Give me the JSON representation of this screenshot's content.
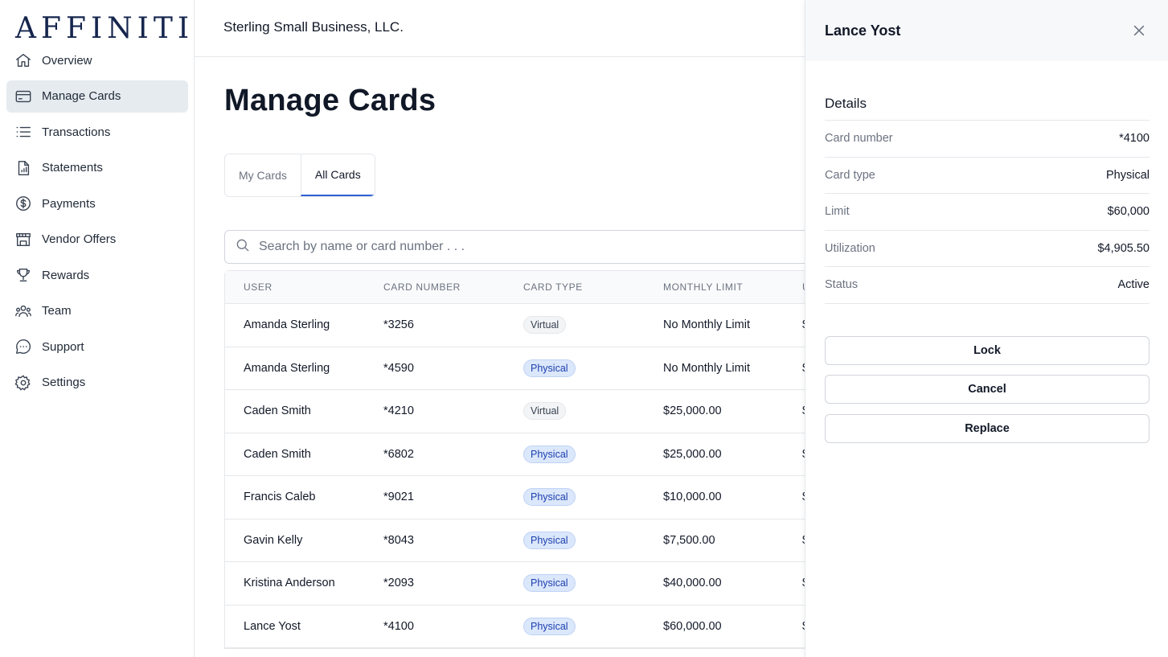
{
  "brand": {
    "logo_text": "AFFINITI",
    "logo_color": "#15254d"
  },
  "sidebar": {
    "items": [
      {
        "label": "Overview",
        "icon": "home-icon"
      },
      {
        "label": "Manage Cards",
        "icon": "credit-card-icon",
        "active": true
      },
      {
        "label": "Transactions",
        "icon": "list-icon"
      },
      {
        "label": "Statements",
        "icon": "document-chart-icon"
      },
      {
        "label": "Payments",
        "icon": "dollar-circle-icon"
      },
      {
        "label": "Vendor Offers",
        "icon": "storefront-icon"
      },
      {
        "label": "Rewards",
        "icon": "trophy-icon"
      },
      {
        "label": "Team",
        "icon": "users-icon"
      },
      {
        "label": "Support",
        "icon": "chat-bubble-icon"
      },
      {
        "label": "Settings",
        "icon": "gear-icon"
      }
    ]
  },
  "header": {
    "company": "Sterling Small Business, LLC."
  },
  "main": {
    "title": "Manage Cards",
    "tabs": [
      {
        "label": "My Cards"
      },
      {
        "label": "All Cards",
        "active": true
      }
    ],
    "search": {
      "placeholder": "Search by name or card number . . ."
    },
    "table": {
      "headers": [
        "USER",
        "CARD NUMBER",
        "CARD TYPE",
        "MONTHLY LIMIT",
        "U"
      ],
      "rows": [
        {
          "user": "Amanda Sterling",
          "card": "*3256",
          "type": "Virtual",
          "limit": "No Monthly Limit",
          "extra": "$"
        },
        {
          "user": "Amanda Sterling",
          "card": "*4590",
          "type": "Physical",
          "limit": "No Monthly Limit",
          "extra": "$"
        },
        {
          "user": "Caden Smith",
          "card": "*4210",
          "type": "Virtual",
          "limit": "$25,000.00",
          "extra": "$"
        },
        {
          "user": "Caden Smith",
          "card": "*6802",
          "type": "Physical",
          "limit": "$25,000.00",
          "extra": "$"
        },
        {
          "user": "Francis Caleb",
          "card": "*9021",
          "type": "Physical",
          "limit": "$10,000.00",
          "extra": "$"
        },
        {
          "user": "Gavin Kelly",
          "card": "*8043",
          "type": "Physical",
          "limit": "$7,500.00",
          "extra": "$"
        },
        {
          "user": "Kristina Anderson",
          "card": "*2093",
          "type": "Physical",
          "limit": "$40,000.00",
          "extra": "$"
        },
        {
          "user": "Lance Yost",
          "card": "*4100",
          "type": "Physical",
          "limit": "$60,000.00",
          "extra": "$"
        }
      ]
    }
  },
  "panel": {
    "title": "Lance Yost",
    "details_title": "Details",
    "details": [
      {
        "label": "Card number",
        "value": "*4100"
      },
      {
        "label": "Card type",
        "value": "Physical"
      },
      {
        "label": "Limit",
        "value": "$60,000"
      },
      {
        "label": "Utilization",
        "value": "$4,905.50"
      },
      {
        "label": "Status",
        "value": "Active"
      }
    ],
    "buttons": {
      "lock": "Lock",
      "cancel": "Cancel",
      "replace": "Replace"
    }
  },
  "colors": {
    "accent": "#2f5fd6",
    "active_nav_bg": "#e6ebef",
    "physical_badge_bg": "#dbe7fb"
  }
}
